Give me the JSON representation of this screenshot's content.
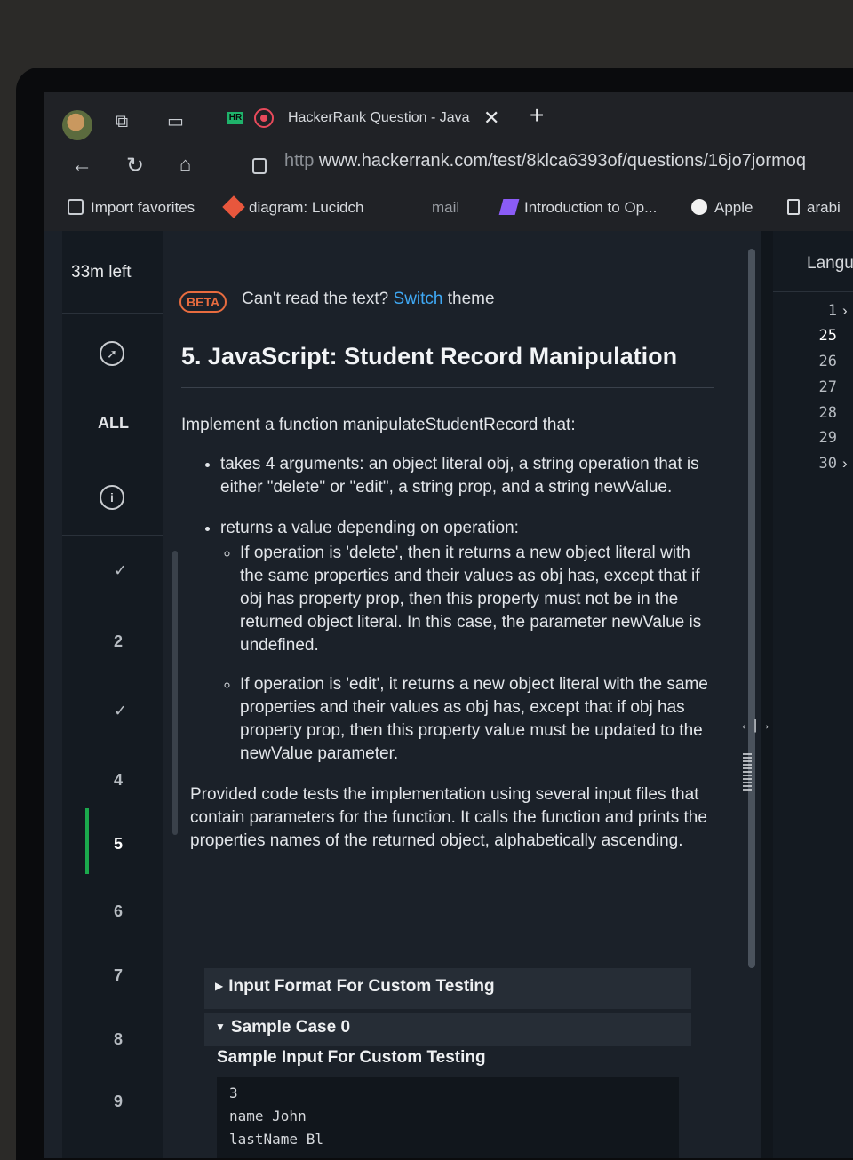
{
  "browser": {
    "tab_title": "HackerRank Question - Java",
    "tab_badge": "HR",
    "url_prefix": "http",
    "url": "www.hackerrank.com/test/8klca6393of/questions/16jo7jormoq",
    "favorites": [
      "Import favorites",
      "diagram: Lucidch",
      "mail",
      "Introduction to Op...",
      "Apple",
      "arabi"
    ]
  },
  "sidebar": {
    "time_left": "33m left",
    "all_label": "ALL",
    "questions": [
      {
        "label": "✓",
        "state": "done"
      },
      {
        "label": "2",
        "state": "pending"
      },
      {
        "label": "✓",
        "state": "done"
      },
      {
        "label": "4",
        "state": "pending"
      },
      {
        "label": "5",
        "state": "active"
      },
      {
        "label": "6",
        "state": "pending"
      },
      {
        "label": "7",
        "state": "pending"
      },
      {
        "label": "8",
        "state": "pending"
      },
      {
        "label": "9",
        "state": "pending"
      }
    ]
  },
  "content": {
    "beta": "BETA",
    "theme_prefix": "Can't read the text?",
    "theme_link": "Switch",
    "theme_suffix": "theme",
    "title": "5. JavaScript: Student Record Manipulation",
    "intro": "Implement a function manipulateStudentRecord that:",
    "bullet1": "takes 4 arguments: an object literal obj, a string operation that is either \"delete\" or \"edit\", a string prop, and a string newValue.",
    "bullet2": "returns a value depending on operation:",
    "sub1": "If operation is 'delete', then it returns a new object literal with the same properties and their values as obj has, except that if obj has property prop, then this property must not be in the returned object literal. In this case, the parameter newValue is undefined.",
    "sub2": "If operation is 'edit', it returns a new object literal with the same properties and their values as obj has, except that if obj has property prop, then this property value must be updated to the newValue parameter.",
    "provided": "Provided code tests the implementation using several input files that contain parameters for the function. It calls the function and prints the properties names of the returned object, alphabetically ascending.",
    "input_format": "Input Format For Custom Testing",
    "sample_case": "Sample Case 0",
    "sample_input_heading": "Sample Input For Custom Testing",
    "sample_lines": [
      "3",
      "name John",
      "lastName Bl"
    ]
  },
  "editor": {
    "language_label": "Langu",
    "line_numbers": [
      "1",
      "25",
      "26",
      "27",
      "28",
      "29",
      "30"
    ]
  },
  "colors": {
    "accent": "#3fa9f5",
    "beta": "#e86c3f",
    "active": "#1ba94c",
    "background": "#1b2129"
  }
}
